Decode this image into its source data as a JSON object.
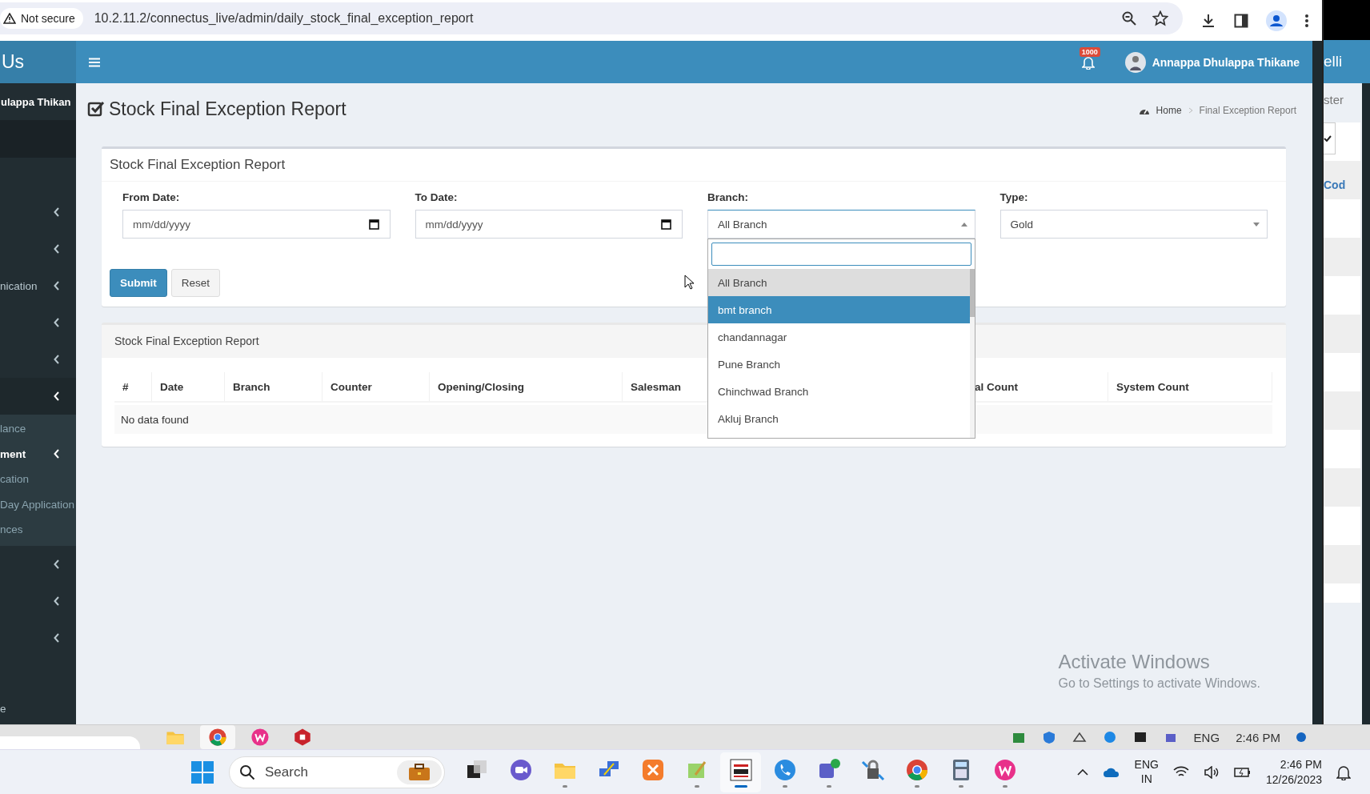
{
  "browser": {
    "security": "Not secure",
    "url": "10.2.11.2/connectus_live/admin/daily_stock_final_exception_report"
  },
  "header": {
    "logo": "Us",
    "notification_count": "1000",
    "user_name": "Annappa Dhulappa Thikane"
  },
  "sidebar": {
    "user_name": "ulappa Thikan",
    "items": [
      {
        "kind": "tree",
        "expanded": false
      },
      {
        "kind": "tree",
        "expanded": false
      },
      {
        "kind": "tree",
        "label": "nication",
        "expanded": false
      },
      {
        "kind": "tree",
        "expanded": false
      },
      {
        "kind": "tree",
        "expanded": false
      },
      {
        "kind": "tree",
        "expanded": true,
        "children": [
          {
            "kind": "link",
            "label": "lance",
            "selected": false
          },
          {
            "kind": "tree",
            "label": "ment",
            "selected": true
          },
          {
            "kind": "link",
            "label": "cation",
            "selected": false
          },
          {
            "kind": "link",
            "label": "Day Application",
            "selected": false
          },
          {
            "kind": "link",
            "label": "nces",
            "selected": false
          }
        ]
      },
      {
        "kind": "tree",
        "expanded": false
      },
      {
        "kind": "tree",
        "expanded": false
      },
      {
        "kind": "tree",
        "expanded": false
      },
      {
        "kind": "link",
        "label": "e"
      }
    ]
  },
  "page": {
    "title": "Stock Final Exception Report",
    "breadcrumb": [
      "Home",
      "Final Exception Report"
    ]
  },
  "filter_box": {
    "title": "Stock Final Exception Report",
    "fields": [
      {
        "kind": "date",
        "label": "From Date:",
        "placeholder": "mm/dd/yyyy"
      },
      {
        "kind": "date",
        "label": "To Date:",
        "placeholder": "mm/dd/yyyy"
      },
      {
        "kind": "select",
        "label": "Branch:",
        "value": "All Branch",
        "expanded": true,
        "options": [
          {
            "label": "All Branch",
            "selected": true,
            "highlighted": false
          },
          {
            "label": "bmt branch",
            "selected": false,
            "highlighted": true
          },
          {
            "label": "chandannagar",
            "selected": false,
            "highlighted": false
          },
          {
            "label": "Pune Branch",
            "selected": false,
            "highlighted": false
          },
          {
            "label": "Chinchwad Branch",
            "selected": false,
            "highlighted": false
          },
          {
            "label": "Akluj Branch",
            "selected": false,
            "highlighted": false
          }
        ]
      },
      {
        "kind": "select",
        "label": "Type:",
        "value": "Gold",
        "expanded": false
      }
    ],
    "buttons": [
      {
        "kind": "primary",
        "label": "Submit"
      },
      {
        "kind": "default",
        "label": "Reset"
      }
    ]
  },
  "report_box": {
    "title": "Stock Final Exception Report",
    "columns": [
      "#",
      "Date",
      "Branch",
      "Counter",
      "Opening/Closing",
      "Salesman",
      "al Count",
      "System Count"
    ],
    "empty_message": "No data found"
  },
  "side_window": {
    "header": "elli",
    "label": "ster",
    "link": "Cod"
  },
  "activation": {
    "title": "Activate Windows",
    "text": "Go to Settings to activate Windows."
  },
  "remote_taskbar": {
    "apps": [
      {
        "kind": "folder",
        "active": false
      },
      {
        "kind": "chrome",
        "active": true
      },
      {
        "kind": "wps",
        "active": false
      },
      {
        "kind": "red",
        "active": false
      }
    ],
    "tray": [
      {
        "kind": "grid"
      },
      {
        "kind": "shield"
      },
      {
        "kind": "network"
      },
      {
        "kind": "bluetooth"
      },
      {
        "kind": "v"
      },
      {
        "kind": "teams"
      }
    ],
    "language": "ENG",
    "time": "2:46 PM"
  },
  "taskbar": {
    "search_placeholder": "Search",
    "apps": [
      {
        "kind": "taskview",
        "running": false,
        "active": false
      },
      {
        "kind": "meet",
        "running": false,
        "active": false
      },
      {
        "kind": "folder",
        "running": true,
        "active": false
      },
      {
        "kind": "network",
        "running": false,
        "active": false
      },
      {
        "kind": "xampp",
        "running": false,
        "active": false
      },
      {
        "kind": "notepad",
        "running": true,
        "active": false
      },
      {
        "kind": "vnc",
        "running": true,
        "active": true
      },
      {
        "kind": "phone",
        "running": true,
        "active": false
      },
      {
        "kind": "teams",
        "running": true,
        "active": false
      },
      {
        "kind": "lock",
        "running": false,
        "active": false
      },
      {
        "kind": "chrome",
        "running": true,
        "active": false
      },
      {
        "kind": "calculator",
        "running": true,
        "active": false
      },
      {
        "kind": "wps",
        "running": true,
        "active": false
      }
    ],
    "language": "ENG",
    "region": "IN",
    "time": "2:46 PM",
    "date": "12/26/2023"
  }
}
